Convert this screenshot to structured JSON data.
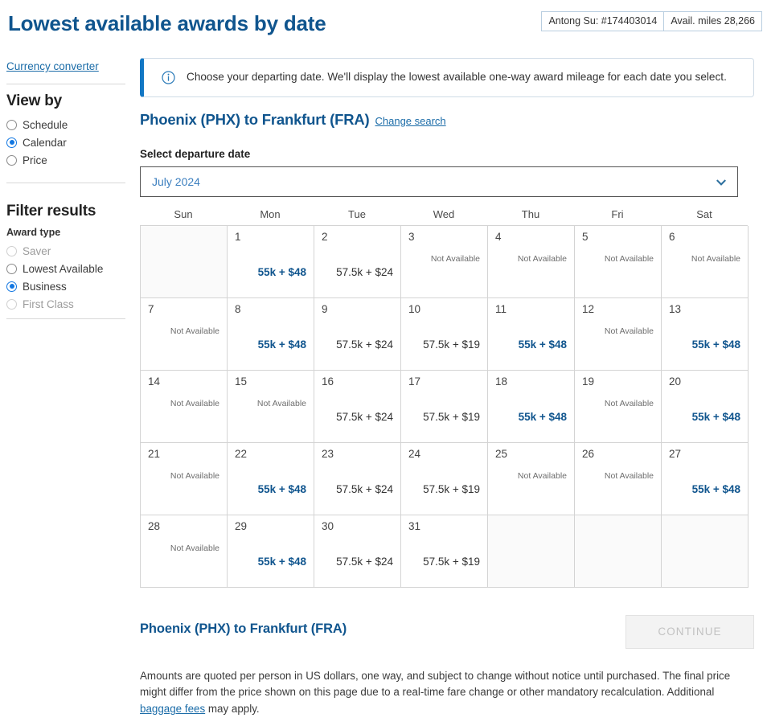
{
  "header": {
    "title": "Lowest available awards by date",
    "account_name": "Antong Su: #174403014",
    "available_miles": "Avail. miles 28,266"
  },
  "sidebar": {
    "currency_converter_label": "Currency converter",
    "view_by": {
      "heading": "View by",
      "options": [
        {
          "label": "Schedule",
          "selected": false,
          "disabled": false
        },
        {
          "label": "Calendar",
          "selected": true,
          "disabled": false
        },
        {
          "label": "Price",
          "selected": false,
          "disabled": false
        }
      ]
    },
    "filter_results": {
      "heading": "Filter results",
      "sublabel": "Award type",
      "options": [
        {
          "label": "Saver",
          "selected": false,
          "disabled": true
        },
        {
          "label": "Lowest Available",
          "selected": false,
          "disabled": false
        },
        {
          "label": "Business",
          "selected": true,
          "disabled": false
        },
        {
          "label": "First Class",
          "selected": false,
          "disabled": true
        }
      ]
    }
  },
  "main": {
    "info_banner": "Choose your departing date. We'll display the lowest available one-way award mileage for each date you select.",
    "route_title": "Phoenix (PHX) to Frankfurt (FRA)",
    "change_search_label": "Change search",
    "select_label": "Select departure date",
    "month_value": "July 2024",
    "weekdays": [
      "Sun",
      "Mon",
      "Tue",
      "Wed",
      "Thu",
      "Fri",
      "Sat"
    ],
    "not_available_text": "Not Available",
    "calendar": [
      {
        "day": "",
        "price": "",
        "available": false,
        "blank": true,
        "best": false
      },
      {
        "day": "1",
        "price": "55k + $48",
        "available": true,
        "blank": false,
        "best": true
      },
      {
        "day": "2",
        "price": "57.5k + $24",
        "available": true,
        "blank": false,
        "best": false
      },
      {
        "day": "3",
        "price": "",
        "available": false,
        "blank": false,
        "best": false
      },
      {
        "day": "4",
        "price": "",
        "available": false,
        "blank": false,
        "best": false
      },
      {
        "day": "5",
        "price": "",
        "available": false,
        "blank": false,
        "best": false
      },
      {
        "day": "6",
        "price": "",
        "available": false,
        "blank": false,
        "best": false
      },
      {
        "day": "7",
        "price": "",
        "available": false,
        "blank": false,
        "best": false
      },
      {
        "day": "8",
        "price": "55k + $48",
        "available": true,
        "blank": false,
        "best": true
      },
      {
        "day": "9",
        "price": "57.5k + $24",
        "available": true,
        "blank": false,
        "best": false
      },
      {
        "day": "10",
        "price": "57.5k + $19",
        "available": true,
        "blank": false,
        "best": false
      },
      {
        "day": "11",
        "price": "55k + $48",
        "available": true,
        "blank": false,
        "best": true
      },
      {
        "day": "12",
        "price": "",
        "available": false,
        "blank": false,
        "best": false
      },
      {
        "day": "13",
        "price": "55k + $48",
        "available": true,
        "blank": false,
        "best": true
      },
      {
        "day": "14",
        "price": "",
        "available": false,
        "blank": false,
        "best": false
      },
      {
        "day": "15",
        "price": "",
        "available": false,
        "blank": false,
        "best": false
      },
      {
        "day": "16",
        "price": "57.5k + $24",
        "available": true,
        "blank": false,
        "best": false
      },
      {
        "day": "17",
        "price": "57.5k + $19",
        "available": true,
        "blank": false,
        "best": false
      },
      {
        "day": "18",
        "price": "55k + $48",
        "available": true,
        "blank": false,
        "best": true
      },
      {
        "day": "19",
        "price": "",
        "available": false,
        "blank": false,
        "best": false
      },
      {
        "day": "20",
        "price": "55k + $48",
        "available": true,
        "blank": false,
        "best": true
      },
      {
        "day": "21",
        "price": "",
        "available": false,
        "blank": false,
        "best": false
      },
      {
        "day": "22",
        "price": "55k + $48",
        "available": true,
        "blank": false,
        "best": true
      },
      {
        "day": "23",
        "price": "57.5k + $24",
        "available": true,
        "blank": false,
        "best": false
      },
      {
        "day": "24",
        "price": "57.5k + $19",
        "available": true,
        "blank": false,
        "best": false
      },
      {
        "day": "25",
        "price": "",
        "available": false,
        "blank": false,
        "best": false
      },
      {
        "day": "26",
        "price": "",
        "available": false,
        "blank": false,
        "best": false
      },
      {
        "day": "27",
        "price": "55k + $48",
        "available": true,
        "blank": false,
        "best": true
      },
      {
        "day": "28",
        "price": "",
        "available": false,
        "blank": false,
        "best": false
      },
      {
        "day": "29",
        "price": "55k + $48",
        "available": true,
        "blank": false,
        "best": true
      },
      {
        "day": "30",
        "price": "57.5k + $24",
        "available": true,
        "blank": false,
        "best": false
      },
      {
        "day": "31",
        "price": "57.5k + $19",
        "available": true,
        "blank": false,
        "best": false
      },
      {
        "day": "",
        "price": "",
        "available": false,
        "blank": true,
        "best": false
      },
      {
        "day": "",
        "price": "",
        "available": false,
        "blank": true,
        "best": false
      },
      {
        "day": "",
        "price": "",
        "available": false,
        "blank": true,
        "best": false
      }
    ]
  },
  "footer": {
    "route_title": "Phoenix (PHX) to Frankfurt (FRA)",
    "continue_label": "CONTINUE",
    "disclaimer_part1": "Amounts are quoted per person in US dollars, one way, and subject to change without notice until purchased. The final price might differ from the price shown on this page due to a real-time fare change or other mandatory recalculation. Additional ",
    "disclaimer_link": "baggage fees",
    "disclaimer_part2": " may apply."
  },
  "colors": {
    "brand_blue": "#10558e",
    "link_blue": "#1b6ca8",
    "accent_blue": "#1277e1",
    "banner_bar": "#1277c4"
  }
}
